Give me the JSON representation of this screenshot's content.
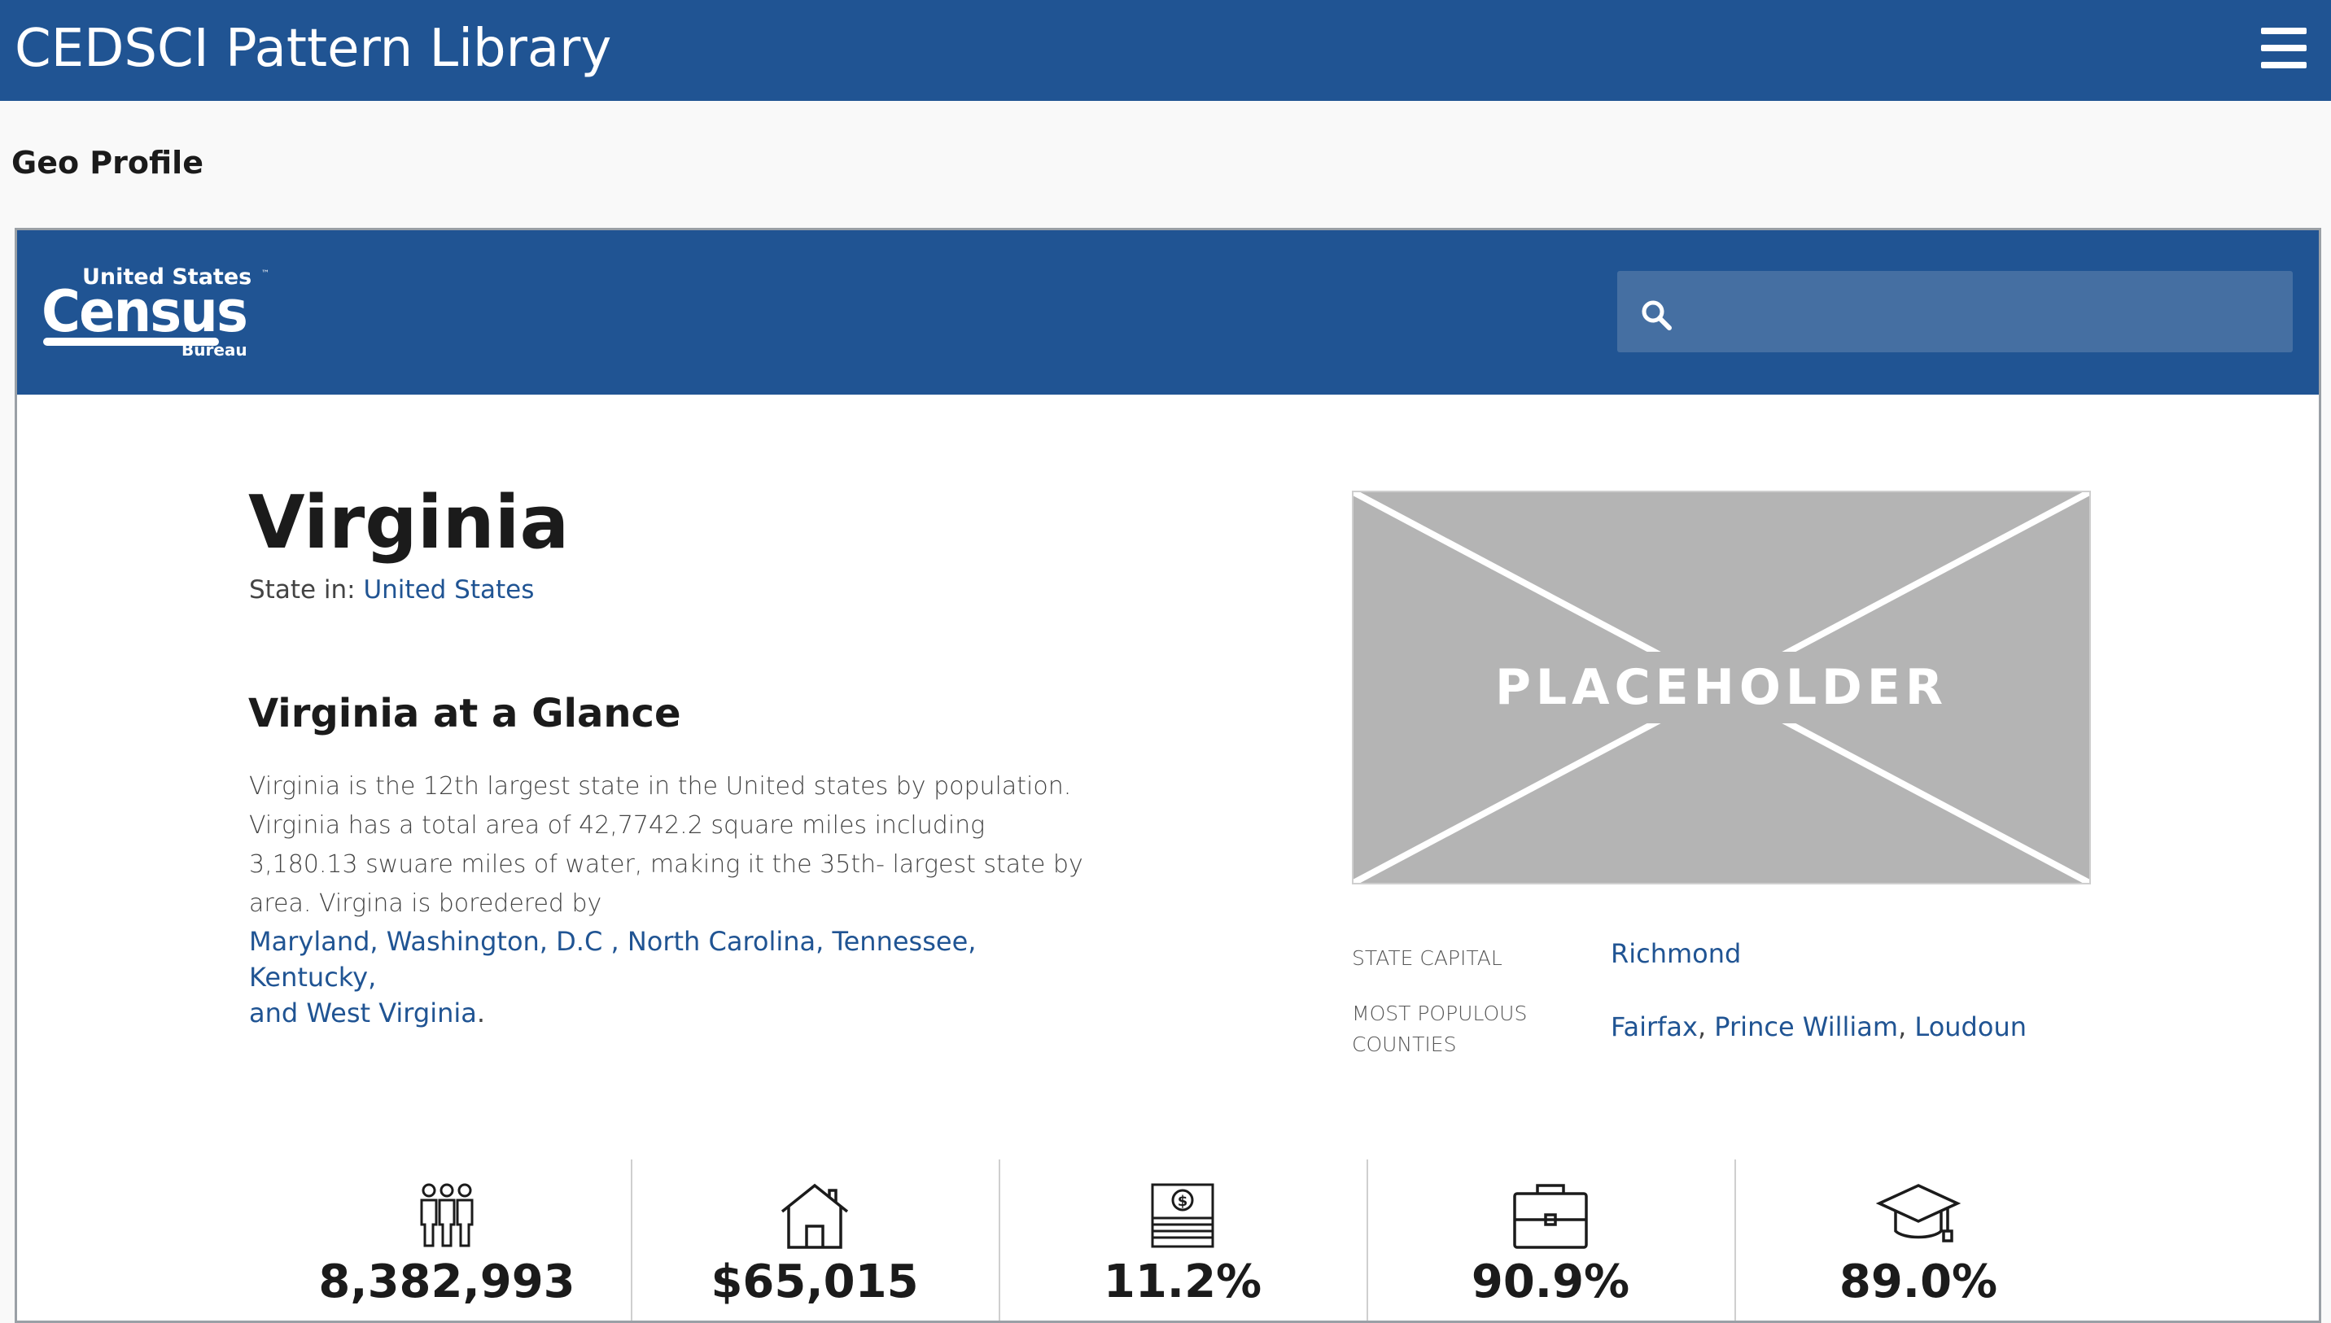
{
  "app": {
    "title": "CEDSCI Pattern Library",
    "menu_icon": "hamburger-menu-icon",
    "brand_color": "#205493"
  },
  "page": {
    "section_heading": "Geo Profile"
  },
  "census": {
    "logo_top": "United States",
    "logo_main": "Census",
    "logo_bottom": "Bureau",
    "logo_tm": "™",
    "search": {
      "icon": "search-icon",
      "value": "",
      "placeholder": ""
    }
  },
  "profile": {
    "name": "Virginia",
    "state_in_label": "State in: ",
    "state_in_link": "United States",
    "glance_title": "Virginia at a Glance",
    "glance_text": "Virginia is the 12th largest state in the United states by population. Virginia has a total area of 42,7742.2 square miles including 3,180.13 swuare miles of water, making it the 35th- largest state by area. Virgina is boredered by",
    "borders": [
      "Maryland, ",
      "Washington, D.C ",
      ", ",
      "North Carolina, ",
      "Tennessee, ",
      "Kentucky, ",
      "and West Virginia"
    ],
    "borders_end": ".",
    "image_label": "PLACEHOLDER",
    "facts": {
      "capital_label": "STATE CAPITAL",
      "capital_value": "Richmond",
      "counties_label": "MOST POPULOUS COUNTIES",
      "counties": [
        "Fairfax",
        "Prince William",
        "Loudoun"
      ],
      "separator": ", "
    }
  },
  "stats": [
    {
      "icon": "people-icon",
      "value": "8,382,993"
    },
    {
      "icon": "house-icon",
      "value": "$65,015"
    },
    {
      "icon": "money-icon",
      "value": "11.2%"
    },
    {
      "icon": "briefcase-icon",
      "value": "90.9%"
    },
    {
      "icon": "graduation-cap-icon",
      "value": "89.0%"
    }
  ]
}
